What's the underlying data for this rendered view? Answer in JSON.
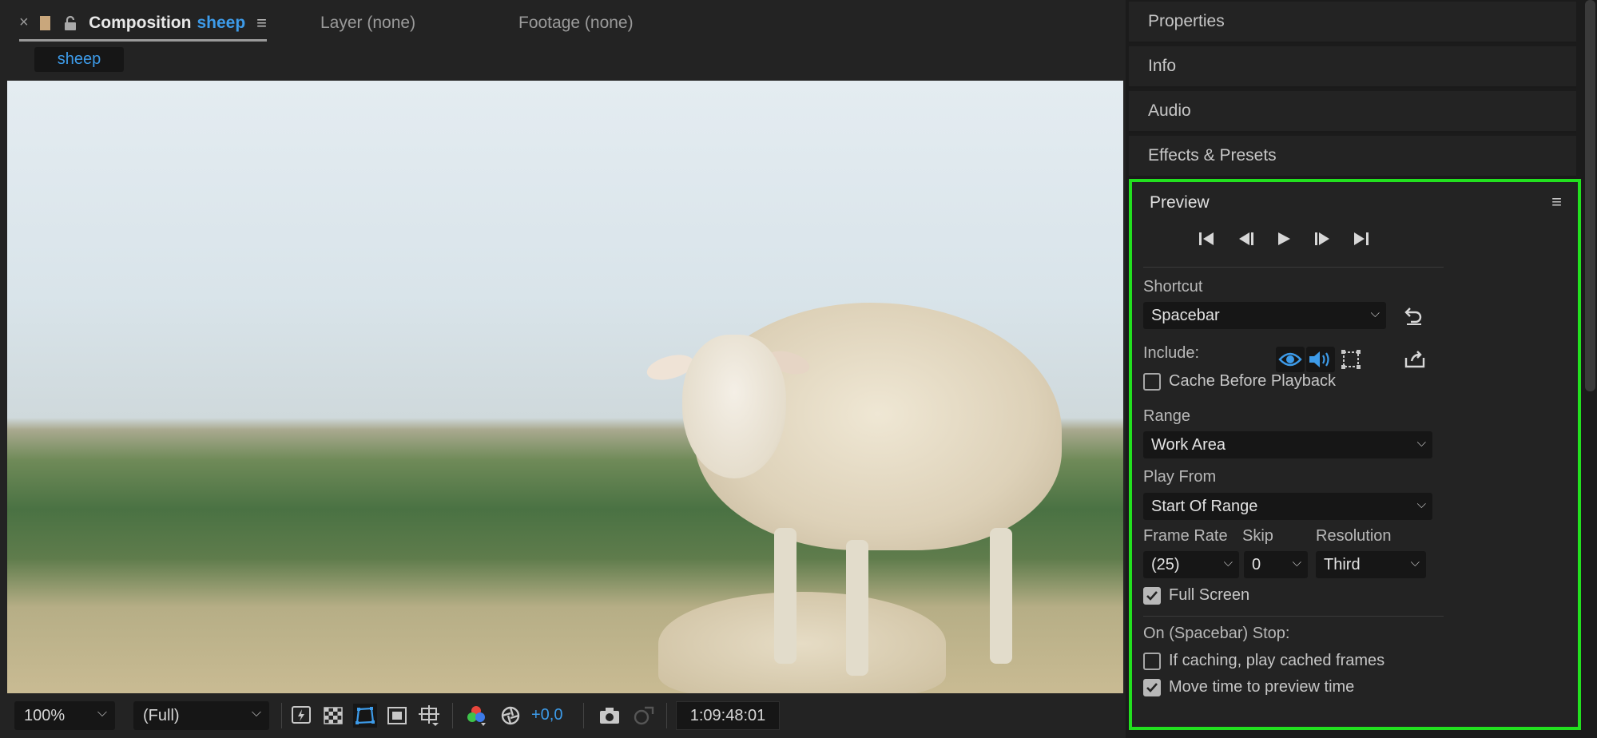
{
  "composition_tab": {
    "close": "×",
    "title": "Composition",
    "name": "sheep",
    "menu": "≡"
  },
  "tabs": {
    "layer": "Layer (none)",
    "footage": "Footage (none)"
  },
  "breadcrumb": "sheep",
  "viewer_toolbar": {
    "magnification": "100%",
    "resolution": "(Full)",
    "exposure": "+0,0",
    "timecode": "1:09:48:01"
  },
  "right_panels": {
    "properties": "Properties",
    "info": "Info",
    "audio": "Audio",
    "effects": "Effects & Presets"
  },
  "preview": {
    "title": "Preview",
    "menu": "≡",
    "shortcut_label": "Shortcut",
    "shortcut_value": "Spacebar",
    "include_label": "Include:",
    "cache_before_playback": "Cache Before Playback",
    "range_label": "Range",
    "range_value": "Work Area",
    "play_from_label": "Play From",
    "play_from_value": "Start Of Range",
    "frame_rate_label": "Frame Rate",
    "skip_label": "Skip",
    "resolution_label": "Resolution",
    "frame_rate_value": "(25)",
    "skip_value": "0",
    "resolution_value": "Third",
    "full_screen": "Full Screen",
    "on_stop_label": "On (Spacebar) Stop:",
    "if_caching": "If caching, play cached frames",
    "move_time": "Move time to preview time"
  },
  "checkbox_states": {
    "cache_before_playback": false,
    "full_screen": true,
    "if_caching": false,
    "move_time": true
  },
  "colors": {
    "accent_blue": "#3d9be9",
    "highlight_green": "#22e01f",
    "panel_bg": "#232323"
  }
}
